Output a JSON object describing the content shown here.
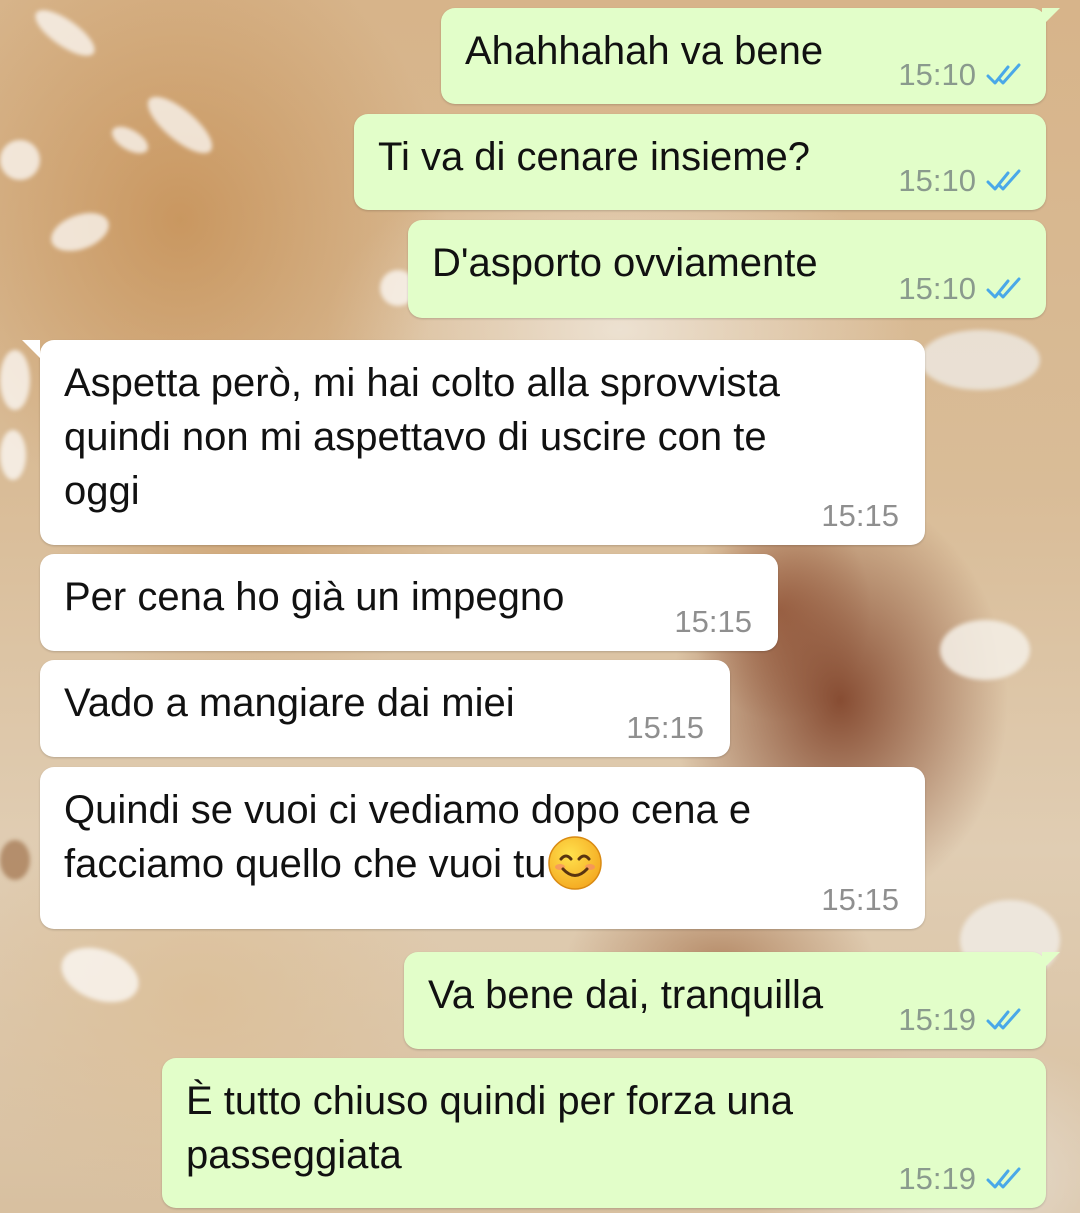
{
  "colors": {
    "outgoing_bubble": "#e2fec9",
    "incoming_bubble": "#ffffff",
    "read_ticks": "#4aa8e8",
    "timestamp": "#8a9a8d"
  },
  "messages": [
    {
      "direction": "out",
      "text": "Ahahhahah va bene",
      "time": "15:10",
      "status_icon": "double-check-read-icon"
    },
    {
      "direction": "out",
      "text": "Ti va di cenare insieme?",
      "time": "15:10",
      "status_icon": "double-check-read-icon"
    },
    {
      "direction": "out",
      "text": "D'asporto ovviamente",
      "time": "15:10",
      "status_icon": "double-check-read-icon"
    },
    {
      "direction": "in",
      "text": "Aspetta però, mi hai colto alla sprovvista\nquindi non mi aspettavo di uscire con te\noggi",
      "time": "15:15"
    },
    {
      "direction": "in",
      "text": "Per cena ho già un impegno",
      "time": "15:15"
    },
    {
      "direction": "in",
      "text": "Vado a mangiare dai miei",
      "time": "15:15"
    },
    {
      "direction": "in",
      "text": "Quindi se vuoi ci vediamo dopo cena e\nfacciamo quello che vuoi tu",
      "emoji": "smiling-face-icon",
      "time": "15:15"
    },
    {
      "direction": "out",
      "text": "Va bene dai, tranquilla",
      "time": "15:19",
      "status_icon": "double-check-read-icon"
    },
    {
      "direction": "out",
      "text": "È tutto chiuso quindi per forza una\npasseggiata",
      "time": "15:19",
      "status_icon": "double-check-read-icon"
    }
  ]
}
